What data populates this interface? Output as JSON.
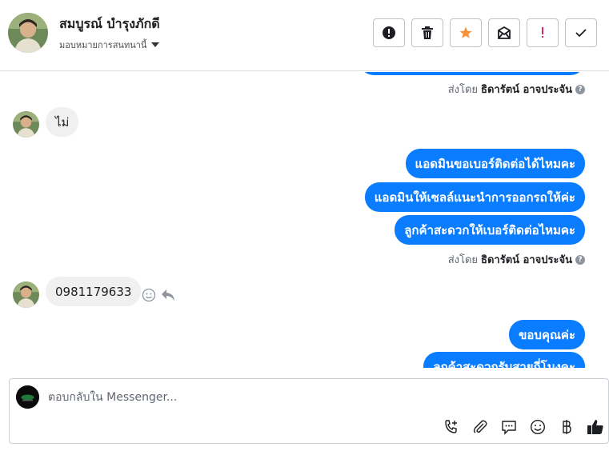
{
  "header": {
    "contact_name": "สมบูรณ์ บำรุงภักดี",
    "assign_label": "มอบหมายการสนทนานี้",
    "actions": [
      {
        "name": "spam-button",
        "icon": "alert-circle-icon"
      },
      {
        "name": "delete-button",
        "icon": "trash-icon"
      },
      {
        "name": "star-button",
        "icon": "star-icon"
      },
      {
        "name": "mark-unread-button",
        "icon": "envelope-icon"
      },
      {
        "name": "important-button",
        "icon": "exclamation-icon"
      },
      {
        "name": "done-button",
        "icon": "check-icon"
      }
    ]
  },
  "messages": {
    "sent_by_prefix": "ส่งโดย",
    "sender_name": "ธิดารัตน์ อาจประจัน",
    "reply_1": "ไม่",
    "out_1": "แอดมินขอเบอร์ติดต่อได้ไหมคะ",
    "out_2": "แอดมินให้เซลล์แนะนำการออกรถให้ค่ะ",
    "out_3": "ลูกค้าสะดวกให้เบอร์ติดต่อไหมคะ",
    "reply_2": "0981179633",
    "out_4": "ขอบคุณค่ะ",
    "out_5": "ลูกค้าสะดวกรับสายกี่โมงคะ"
  },
  "composer": {
    "placeholder": "ตอบกลับใน Messenger...",
    "value": "",
    "tools": [
      "call-add-icon",
      "attachment-icon",
      "saved-replies-icon",
      "emoji-icon",
      "baht-icon",
      "like-icon"
    ]
  },
  "colors": {
    "outgoing_bubble": "#0a7cff",
    "incoming_bubble": "#f0f0f0",
    "star": "#f7923b",
    "important": "#e0245e"
  }
}
